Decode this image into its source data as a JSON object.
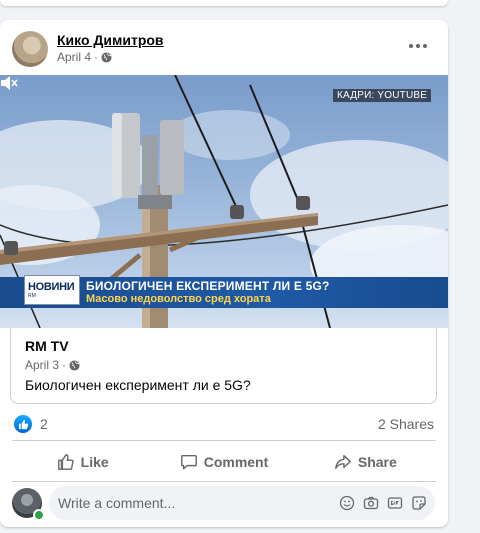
{
  "post": {
    "author": "Кико Димитров",
    "date": "April 4",
    "separator": "·"
  },
  "media": {
    "source_tag": "КАДРИ: YOUTUBE",
    "channel_logo": "НОВИНИ",
    "headline": "БИОЛОГИЧЕН ЕКСПЕРИМЕНТ ЛИ Е 5G?",
    "subheadline": "Масово недоволство сред хората"
  },
  "shared": {
    "name": "RM TV",
    "date": "April 3",
    "separator": "·",
    "text": "Биологичен експеримент ли е 5G?"
  },
  "stats": {
    "like_count": "2",
    "shares": "2 Shares"
  },
  "actions": {
    "like": "Like",
    "comment": "Comment",
    "share": "Share"
  },
  "comment_box": {
    "placeholder": "Write a comment..."
  },
  "colors": {
    "like_blue": "#1877f2",
    "ticker_blue": "#1f5aa6",
    "ticker_yellow": "#ffd54a",
    "online_green": "#31a24c"
  },
  "icons": [
    "globe-icon",
    "more-options-icon",
    "mute-icon",
    "like-icon",
    "comment-icon",
    "share-icon",
    "emoji-icon",
    "camera-icon",
    "gif-icon",
    "sticker-icon"
  ]
}
